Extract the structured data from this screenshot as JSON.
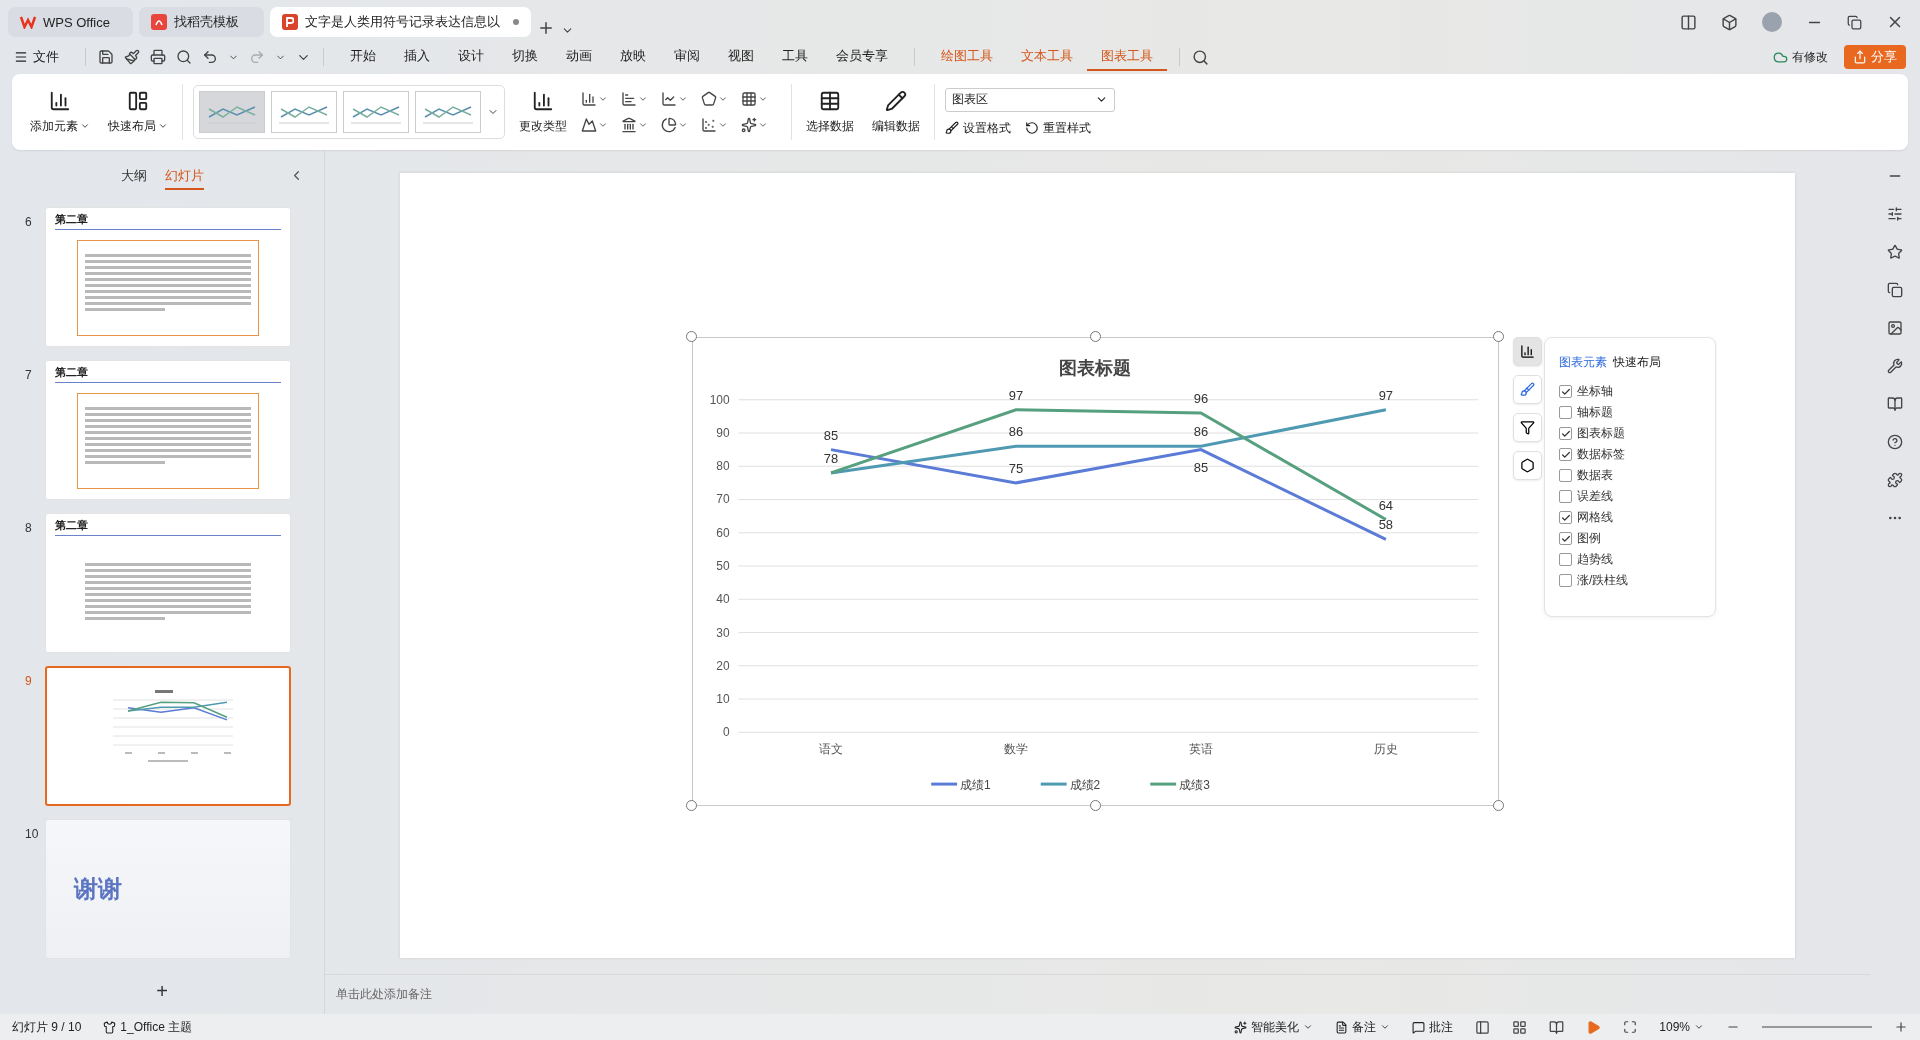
{
  "tabs": [
    {
      "label": "WPS Office",
      "kind": "home",
      "selected": false
    },
    {
      "label": "找稻壳模板",
      "kind": "template",
      "selected": false
    },
    {
      "label": "文字是人类用符号记录表达信息以",
      "kind": "doc",
      "selected": true
    }
  ],
  "menu": {
    "file": "文件",
    "tabs": [
      {
        "label": "开始",
        "kind": "plain",
        "selected": false
      },
      {
        "label": "插入",
        "kind": "plain",
        "selected": false
      },
      {
        "label": "设计",
        "kind": "plain",
        "selected": false
      },
      {
        "label": "切换",
        "kind": "plain",
        "selected": false
      },
      {
        "label": "动画",
        "kind": "plain",
        "selected": false
      },
      {
        "label": "放映",
        "kind": "plain",
        "selected": false
      },
      {
        "label": "审阅",
        "kind": "plain",
        "selected": false
      },
      {
        "label": "视图",
        "kind": "plain",
        "selected": false
      },
      {
        "label": "工具",
        "kind": "plain",
        "selected": false
      },
      {
        "label": "会员专享",
        "kind": "plain",
        "selected": false
      },
      {
        "label": "绘图工具",
        "kind": "context",
        "selected": false
      },
      {
        "label": "文本工具",
        "kind": "context",
        "selected": false
      },
      {
        "label": "图表工具",
        "kind": "context",
        "selected": true
      }
    ],
    "sync": "有修改",
    "share": "分享"
  },
  "ribbon": {
    "add_element": "添加元素",
    "quick_layout": "快速布局",
    "styles": [
      {
        "selected": true
      },
      {
        "selected": false
      },
      {
        "selected": false
      },
      {
        "selected": false
      }
    ],
    "change_type": "更改类型",
    "select_data": "选择数据",
    "edit_data": "编辑数据",
    "area": "图表区",
    "format": "设置格式",
    "reset": "重置样式"
  },
  "slides_panel": {
    "tabs": [
      {
        "label": "大纲",
        "selected": false
      },
      {
        "label": "幻灯片",
        "selected": true
      }
    ],
    "slides": [
      {
        "number": "6",
        "kind": "framed",
        "title": "第二章",
        "selected": false
      },
      {
        "number": "7",
        "kind": "framed",
        "title": "第二章",
        "selected": false
      },
      {
        "number": "8",
        "kind": "plain",
        "title": "第二章",
        "selected": false
      },
      {
        "number": "9",
        "kind": "chart",
        "selected": true
      },
      {
        "number": "10",
        "kind": "thanks",
        "title": "谢谢",
        "selected": false
      }
    ],
    "add": "+"
  },
  "chart": {
    "chart_data": {
      "type": "line",
      "title": "图表标题",
      "categories": [
        "语文",
        "数学",
        "英语",
        "历史"
      ],
      "series": [
        {
          "name": "成绩1",
          "color": "#5a7bd6",
          "values": [
            85,
            75,
            85,
            58
          ]
        },
        {
          "name": "成绩2",
          "color": "#4f9ab2",
          "values": [
            78,
            86,
            86,
            97
          ]
        },
        {
          "name": "成绩3",
          "color": "#57a07f",
          "values": [
            78,
            97,
            96,
            64
          ]
        }
      ],
      "value_labels": [
        [
          "85",
          "75",
          "85",
          "58"
        ],
        [
          "78",
          "86",
          "86",
          "97"
        ],
        [
          null,
          "97",
          "96",
          "64"
        ]
      ],
      "ylim": [
        0,
        100
      ],
      "yticks": [
        0,
        10,
        20,
        30,
        40,
        50,
        60,
        70,
        80,
        90,
        100
      ],
      "grid": true,
      "legend": "bottom"
    }
  },
  "chart_panel": {
    "tabs": [
      {
        "label": "图表元素",
        "selected": true
      },
      {
        "label": "快速布局",
        "selected": false
      }
    ],
    "items": [
      {
        "label": "坐标轴",
        "checked": true
      },
      {
        "label": "轴标题",
        "checked": false
      },
      {
        "label": "图表标题",
        "checked": true
      },
      {
        "label": "数据标签",
        "checked": true
      },
      {
        "label": "数据表",
        "checked": false
      },
      {
        "label": "误差线",
        "checked": false
      },
      {
        "label": "网格线",
        "checked": true
      },
      {
        "label": "图例",
        "checked": true
      },
      {
        "label": "趋势线",
        "checked": false
      },
      {
        "label": "涨/跌柱线",
        "checked": false
      }
    ]
  },
  "notes_placeholder": "单击此处添加备注",
  "status_bar": {
    "slide": "幻灯片 9 / 10",
    "theme": "1_Office 主题",
    "beautify": "智能美化",
    "notes": "备注",
    "comments": "批注",
    "zoom": "109%"
  }
}
